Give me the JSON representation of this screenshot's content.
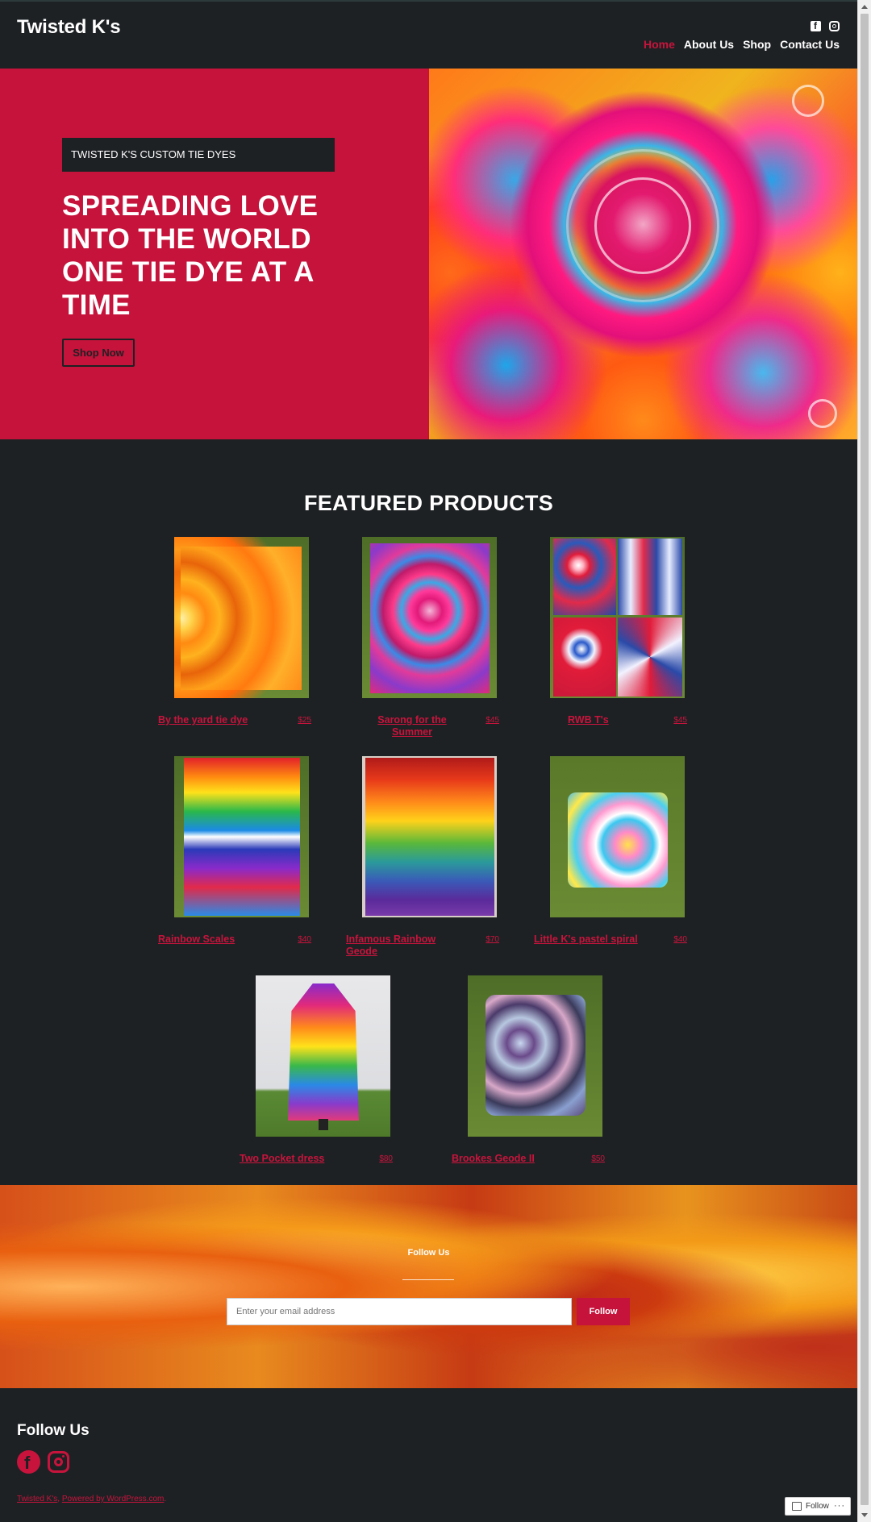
{
  "header": {
    "site_title": "Twisted K's",
    "social": [
      "facebook-icon",
      "instagram-icon"
    ],
    "nav": [
      {
        "label": "Home",
        "active": true
      },
      {
        "label": "About Us",
        "active": false
      },
      {
        "label": "Shop",
        "active": false
      },
      {
        "label": "Contact Us",
        "active": false
      }
    ]
  },
  "hero": {
    "badge": "TWISTED K'S CUSTOM TIE DYES",
    "heading": "SPREADING LOVE INTO THE WORLD ONE TIE DYE AT A TIME",
    "button": "Shop Now",
    "background_color": "#c5133b"
  },
  "featured": {
    "title": "FEATURED PRODUCTS",
    "products": [
      {
        "name": "By the yard tie dye",
        "price": "$25"
      },
      {
        "name": "Sarong for the Summer",
        "price": "$45"
      },
      {
        "name": "RWB T's",
        "price": "$45"
      },
      {
        "name": "Rainbow Scales",
        "price": "$40"
      },
      {
        "name": "Infamous Rainbow Geode",
        "price": "$70"
      },
      {
        "name": "Little K's pastel spiral",
        "price": "$40"
      },
      {
        "name": "Two Pocket dress",
        "price": "$80"
      },
      {
        "name": "Brookes Geode II",
        "price": "$50"
      }
    ]
  },
  "subscribe": {
    "title": "Follow Us",
    "email_placeholder": "Enter your email address",
    "button": "Follow"
  },
  "footer": {
    "heading": "Follow Us",
    "credit_site": "Twisted K's",
    "credit_sep": ", ",
    "credit_powered": "Powered by WordPress.com",
    "credit_end": "."
  },
  "wp_follow": {
    "label": "Follow",
    "more": "···"
  },
  "colors": {
    "accent": "#c8143c",
    "background": "#1e2124"
  }
}
